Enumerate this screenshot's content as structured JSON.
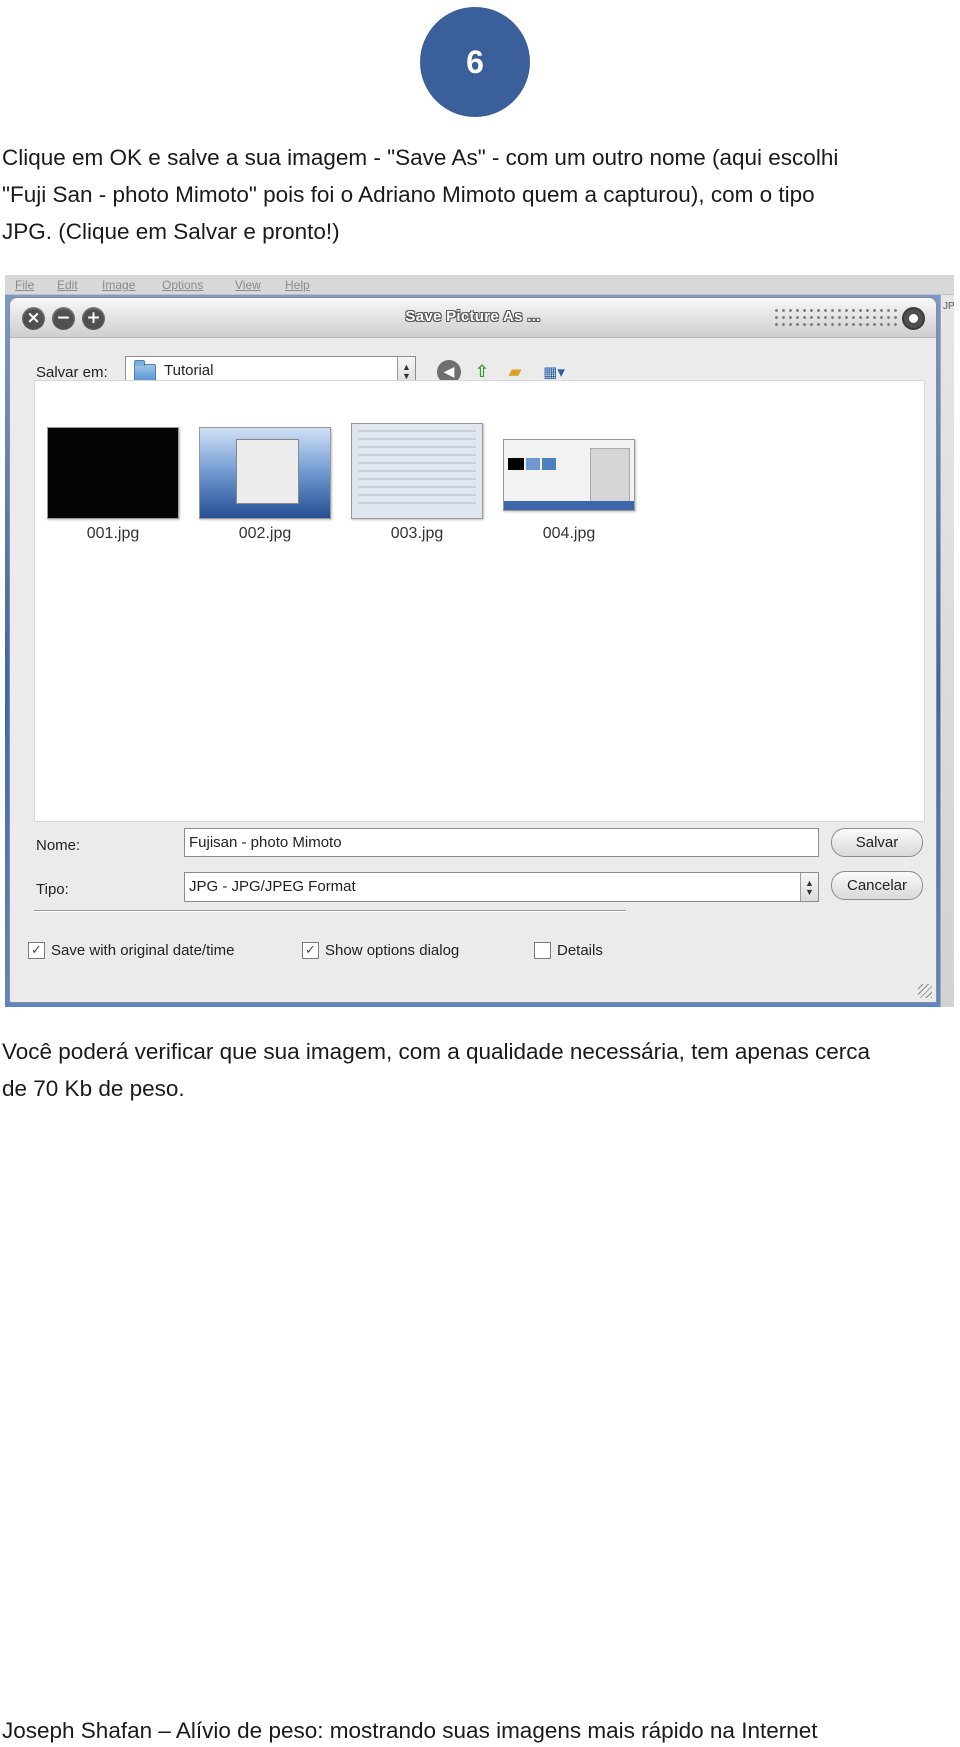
{
  "page": {
    "number": "6",
    "intro_line1": "Clique em OK e salve a sua imagem - \"Save As\" - com um outro nome (aqui escolhi",
    "intro_line2": "\"Fuji San - photo Mimoto\" pois foi o Adriano Mimoto quem a capturou), com o tipo",
    "intro_line3": "JPG. (Clique em Salvar e pronto!)",
    "outro_line1": "Você poderá verificar que sua imagem, com a qualidade necessária, tem apenas cerca",
    "outro_line2": "de 70 Kb de peso.",
    "footer": "Joseph Shafan – Alívio de peso: mostrando suas imagens mais rápido na Internet"
  },
  "screenshot": {
    "menu": [
      "File",
      "Edit",
      "Image",
      "Options",
      "View",
      "Help"
    ],
    "side_fragment": "JP",
    "dialog": {
      "title": "Save Picture As ...",
      "save_in_label": "Salvar em:",
      "save_in_value": "Tutorial",
      "files": [
        {
          "name": "001.jpg"
        },
        {
          "name": "002.jpg"
        },
        {
          "name": "003.jpg"
        },
        {
          "name": "004.jpg"
        }
      ],
      "name_label": "Nome:",
      "name_value": "Fujisan - photo Mimoto",
      "type_label": "Tipo:",
      "type_value": "JPG - JPG/JPEG Format",
      "save_button": "Salvar",
      "cancel_button": "Cancelar",
      "options": [
        {
          "label": "Save with original date/time",
          "checked": true
        },
        {
          "label": "Show options dialog",
          "checked": true
        },
        {
          "label": "Details",
          "checked": false
        }
      ]
    }
  }
}
